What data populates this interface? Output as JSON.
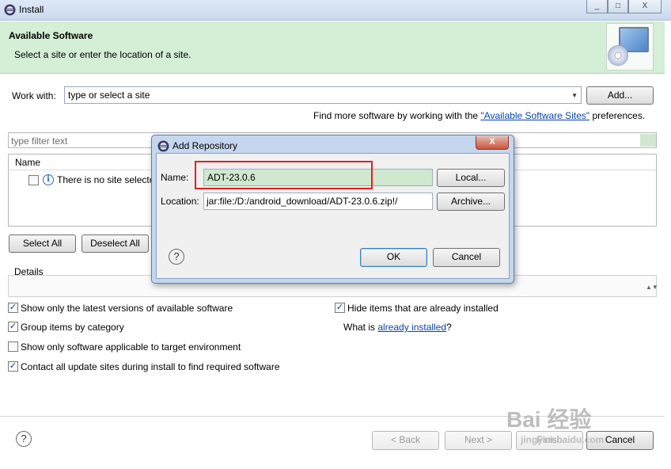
{
  "window": {
    "title": "Install",
    "min": "_",
    "max": "□",
    "close": "X"
  },
  "banner": {
    "heading": "Available Software",
    "subtitle": "Select a site or enter the location of a site."
  },
  "work_with": {
    "label": "Work with:",
    "value": "type or select a site",
    "add_button": "Add..."
  },
  "find_more": {
    "prefix": "Find more software by working with the ",
    "link": "\"Available Software Sites\"",
    "suffix": " preferences."
  },
  "filter": {
    "placeholder": "type filter text"
  },
  "tree": {
    "column": "Name",
    "row_text": "There is no site selected."
  },
  "select_all": "Select All",
  "deselect_all": "Deselect All",
  "details_label": "Details",
  "options": {
    "latest": "Show only the latest versions of available software",
    "group": "Group items by category",
    "applicable": "Show only software applicable to target environment",
    "contact": "Contact all update sites during install to find required software",
    "hide": "Hide items that are already installed",
    "what_is_prefix": "What is ",
    "what_is_link": "already installed",
    "what_is_suffix": "?"
  },
  "nav": {
    "back": "< Back",
    "next": "Next >",
    "finish": "Finish",
    "cancel": "Cancel"
  },
  "dialog": {
    "title": "Add Repository",
    "name_label": "Name:",
    "name_value": "ADT-23.0.6",
    "local_button": "Local...",
    "location_label": "Location:",
    "location_value": "jar:file:/D:/android_download/ADT-23.0.6.zip!/",
    "archive_button": "Archive...",
    "ok": "OK",
    "cancel": "Cancel"
  },
  "watermark": {
    "text": "Bai 经验",
    "sub": "jingyan.baidu.com"
  },
  "colors": {
    "banner": "#d5eed6",
    "highlight_box": "#e52020",
    "name_field": "#cfe8cf",
    "link": "#0645ad"
  }
}
